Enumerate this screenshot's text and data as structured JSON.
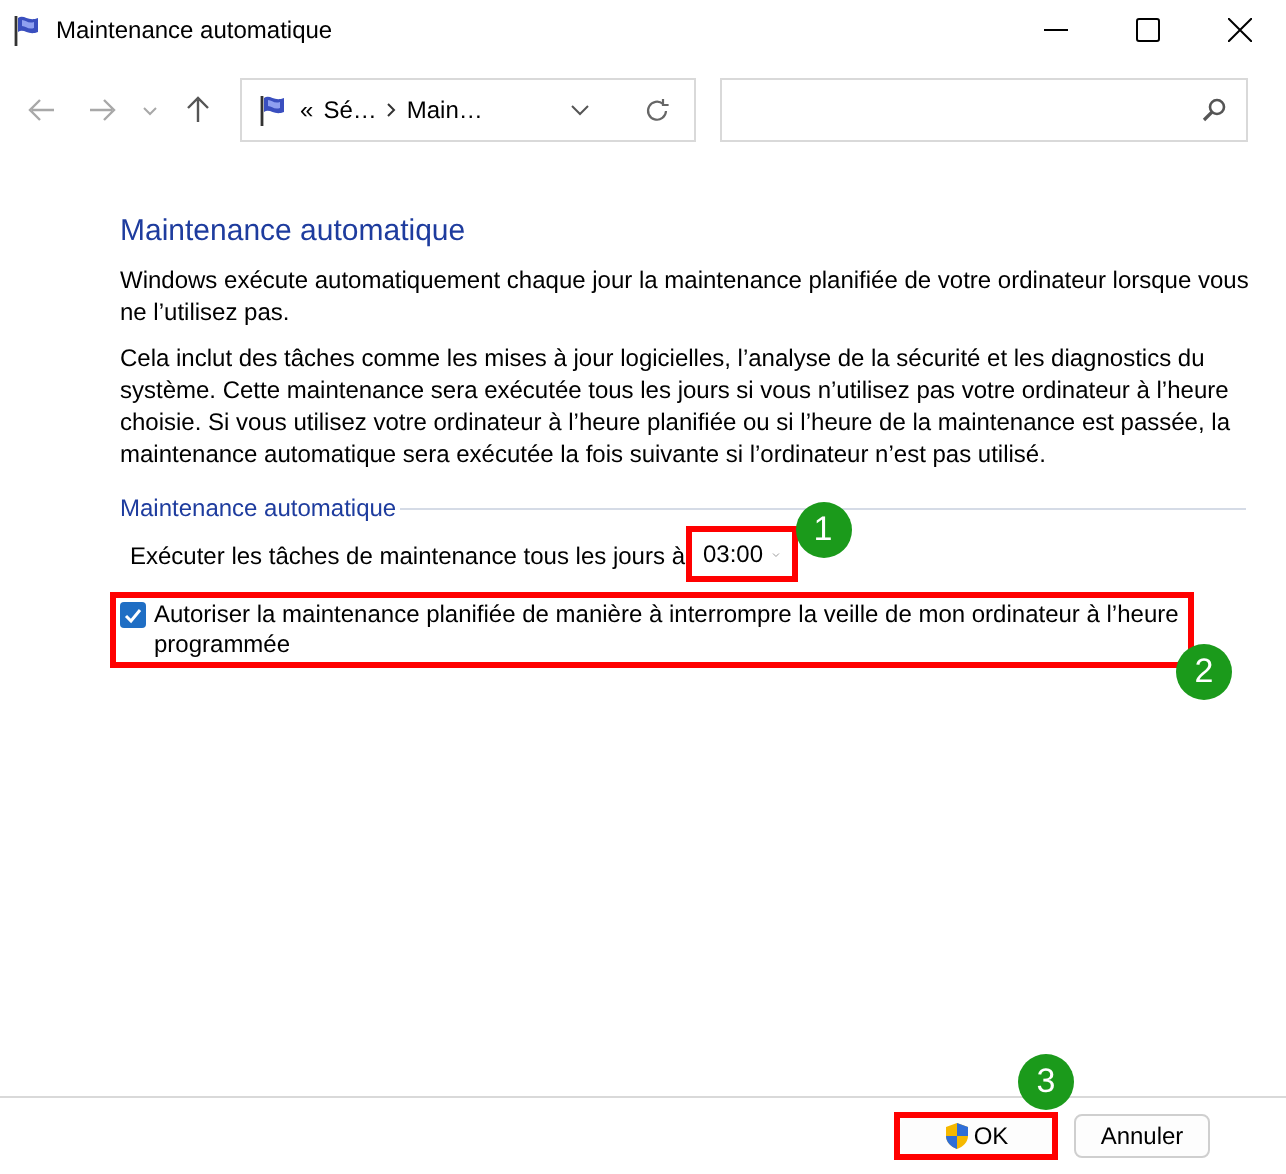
{
  "window": {
    "title": "Maintenance automatique"
  },
  "nav_buttons": [
    {
      "kind": "back",
      "disabled": true
    },
    {
      "kind": "forward",
      "disabled": true
    },
    {
      "kind": "recent",
      "disabled": true
    },
    {
      "kind": "up",
      "disabled": false
    }
  ],
  "address_bar": {
    "overflow": "«",
    "segments": [
      "Sé…",
      "Main…"
    ]
  },
  "heading": "Maintenance automatique",
  "paragraphs": [
    "Windows exécute automatiquement chaque jour la maintenance planifiée de votre ordinateur lorsque vous ne l’utilisez pas.",
    "Cela inclut des tâches comme les mises à jour logicielles, l’analyse de la sécurité et les diagnostics du système. Cette maintenance sera exécutée tous les jours si vous n’utilisez pas votre ordinateur à l’heure choisie. Si vous utilisez votre ordinateur à l’heure planifiée ou si l’heure de la maintenance est passée, la maintenance automatique sera exécutée la fois suivante si l’ordinateur n’est pas utilisé."
  ],
  "group": {
    "legend": "Maintenance automatique",
    "schedule_label": "Exécuter les tâches de maintenance tous les jours à",
    "time": "03:00",
    "wake": {
      "label": "Autoriser la maintenance planifiée de manière à interrompre la veille de mon ordinateur à l’heure programmée",
      "checked": true
    }
  },
  "buttons": [
    {
      "label": "OK",
      "kind": "shield"
    },
    {
      "label": "Annuler",
      "kind": "plain"
    }
  ],
  "annotations": [
    {
      "label": "1"
    },
    {
      "label": "2"
    },
    {
      "label": "3"
    }
  ]
}
